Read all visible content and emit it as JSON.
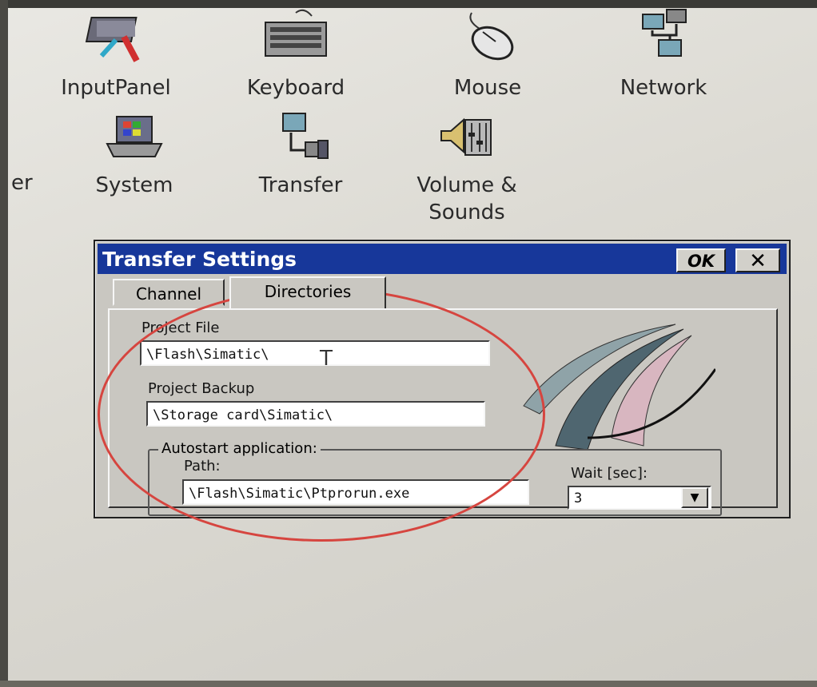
{
  "desktop": {
    "icons": [
      {
        "label": "InputPanel",
        "icon": "input-panel-icon"
      },
      {
        "label": "Keyboard",
        "icon": "keyboard-icon"
      },
      {
        "label": "Mouse",
        "icon": "mouse-icon"
      },
      {
        "label": "Network",
        "icon": "network-icon"
      },
      {
        "label": "er",
        "icon": "partial-icon"
      },
      {
        "label": "System",
        "icon": "system-icon"
      },
      {
        "label": "Transfer",
        "icon": "transfer-icon"
      },
      {
        "label": "Volume &\nSounds",
        "icon": "volume-sounds-icon"
      }
    ]
  },
  "dialog": {
    "title": "Transfer Settings",
    "ok_label": "OK",
    "close_label": "✕",
    "tabs": [
      {
        "label": "Channel",
        "active": false
      },
      {
        "label": "Directories",
        "active": true
      }
    ],
    "project_file": {
      "label": "Project File",
      "value": "\\Flash\\Simatic\\"
    },
    "project_backup": {
      "label": "Project Backup",
      "value": "\\Storage card\\Simatic\\"
    },
    "autostart": {
      "group_label": "Autostart application:",
      "path_label": "Path:",
      "path_value": "\\Flash\\Simatic\\Ptprorun.exe",
      "wait_label": "Wait [sec]:",
      "wait_value": "3"
    }
  },
  "colors": {
    "title_bar": "#17379a",
    "dialog_bg": "#c9c7c1",
    "annotation": "#d6453f"
  }
}
